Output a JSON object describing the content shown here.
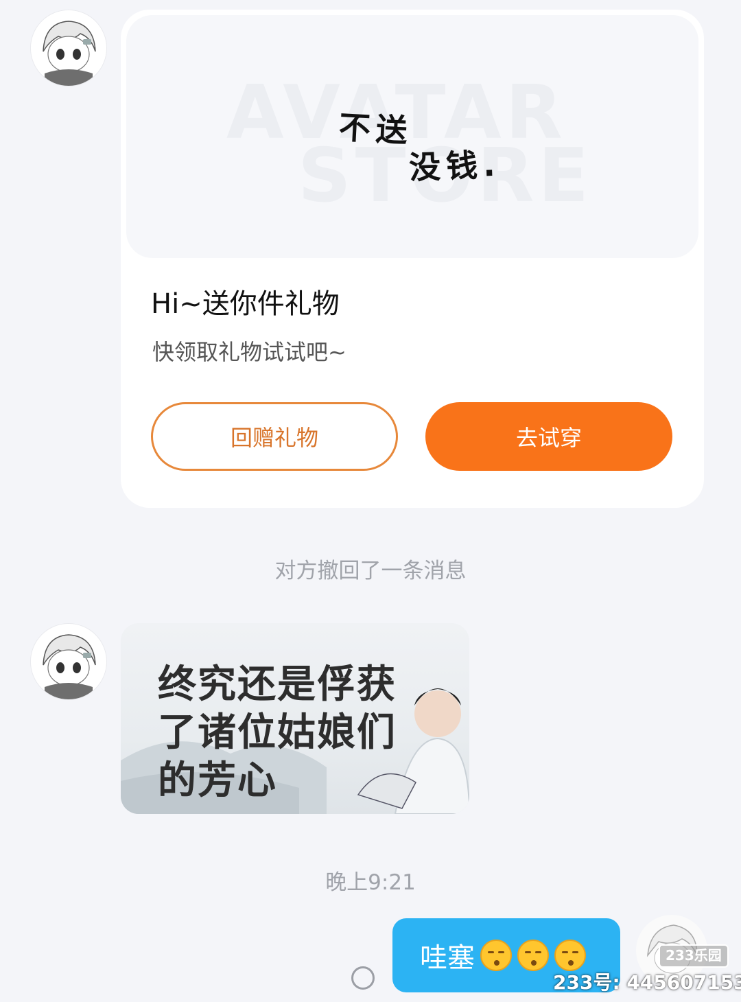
{
  "gift_card": {
    "image_watermark_top": "AVATAR",
    "image_watermark_bottom": "STORE",
    "image_text_line1": "不送",
    "image_text_line2": "没钱.",
    "title": "Hi~送你件礼物",
    "subtitle": "快领取礼物试试吧~",
    "return_gift_label": "回赠礼物",
    "try_on_label": "去试穿"
  },
  "recall_notice": "对方撤回了一条消息",
  "sticker": {
    "lines": [
      "终究还是俘获",
      "了诸位姑娘们",
      "的芳心"
    ]
  },
  "timestamp": "晚上9:21",
  "outgoing_message": {
    "text": "哇塞",
    "emoji_icons": [
      "kissing-face-icon",
      "kissing-face-icon",
      "kissing-face-icon"
    ]
  },
  "watermark": {
    "badge": "233乐园",
    "id_text": "233号: 445607153"
  },
  "colors": {
    "background": "#f4f5f9",
    "accent_orange": "#f97319",
    "outgoing_bubble": "#2cb3f3"
  }
}
